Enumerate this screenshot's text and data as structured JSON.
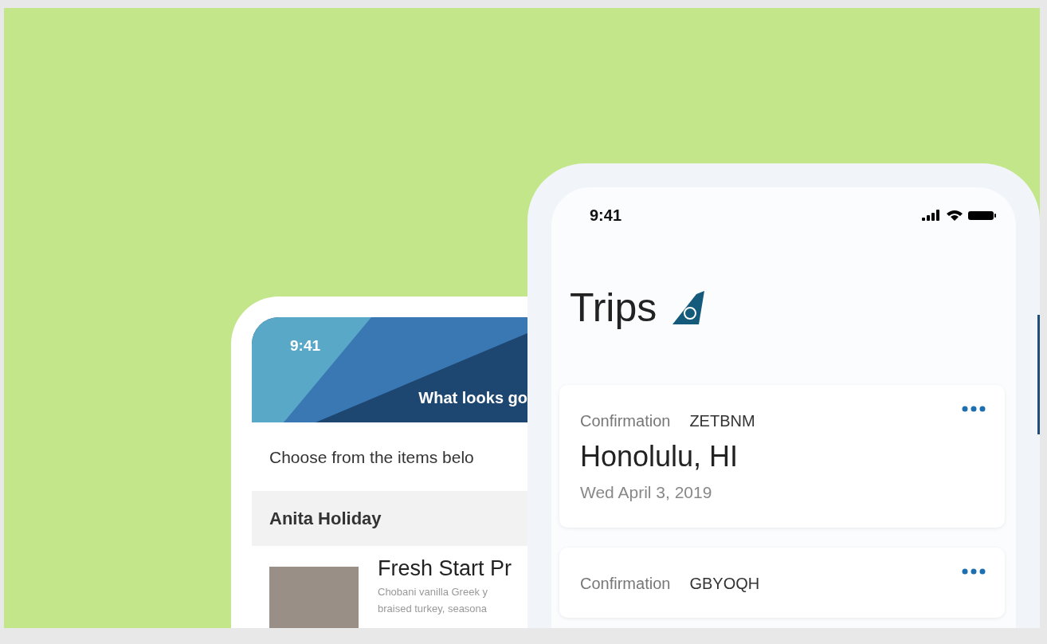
{
  "menu_phone": {
    "time": "9:41",
    "header_title": "What looks go",
    "intro": "Choose from the items belo",
    "section": "Anita Holiday",
    "items": [
      {
        "title": "Fresh Start Pr",
        "description": "Chobani vanilla Greek y\nbraised turkey, seasona"
      }
    ]
  },
  "trips_phone": {
    "time": "9:41",
    "title": "Trips",
    "trips": [
      {
        "label": "Confirmation",
        "code": "ZETBNM",
        "destination": "Honolulu, HI",
        "date": "Wed April 3, 2019"
      },
      {
        "label": "Confirmation",
        "code": "GBYOQH"
      }
    ]
  }
}
